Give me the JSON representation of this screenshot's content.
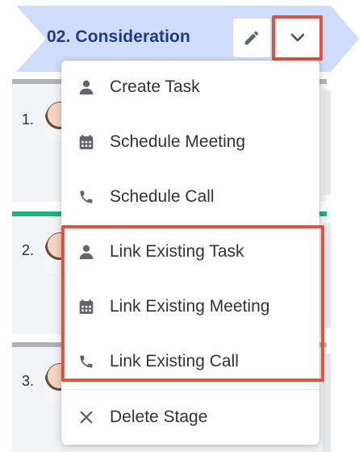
{
  "stage": {
    "title": "02. Consideration"
  },
  "cards": [
    {
      "number": "1."
    },
    {
      "number": "2."
    },
    {
      "number": "3."
    }
  ],
  "menu": {
    "items": [
      {
        "label": "Create Task",
        "icon": "person-icon"
      },
      {
        "label": "Schedule Meeting",
        "icon": "calendar-icon"
      },
      {
        "label": "Schedule Call",
        "icon": "phone-icon"
      },
      {
        "label": "Link Existing Task",
        "icon": "person-icon"
      },
      {
        "label": "Link Existing Meeting",
        "icon": "calendar-icon"
      },
      {
        "label": "Link Existing Call",
        "icon": "phone-icon"
      },
      {
        "label": "Delete Stage",
        "icon": "close-icon"
      }
    ]
  },
  "colors": {
    "header_bg": "#cfdcfb",
    "header_text": "#1f3a8c",
    "highlight": "#e0533f",
    "icon": "#5f666d",
    "active_bar": "#1fb27a"
  }
}
